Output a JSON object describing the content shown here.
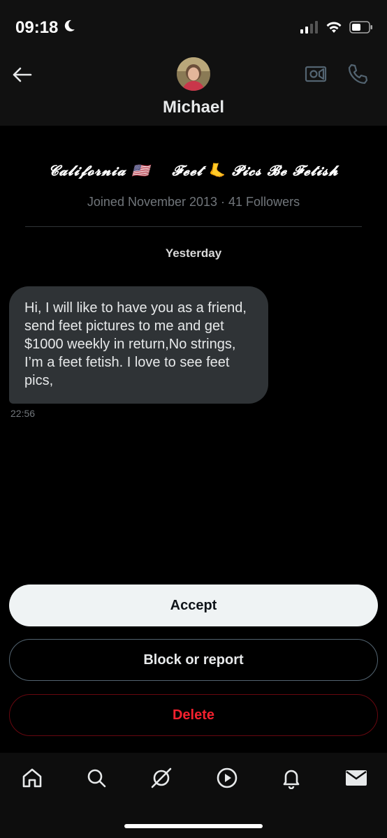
{
  "status_bar": {
    "time": "09:18",
    "icons": [
      "moon-icon",
      "signal-icon",
      "wifi-icon",
      "battery-icon"
    ]
  },
  "header": {
    "name": "Michael",
    "icons": [
      "back-arrow-icon",
      "video-camera-icon",
      "phone-icon"
    ]
  },
  "profile": {
    "bio": "𝓒𝓪𝓵𝓲𝓯𝓸𝓻𝓷𝓲𝓪 🇺🇸    𝓕𝓮𝓮𝓽 🦶 𝓟𝓲𝓬𝓼 𝓑𝓮 𝓕𝓮𝓽𝓲𝓼𝓱",
    "joined": "Joined November 2013",
    "separator": "·",
    "followers": "41 Followers"
  },
  "conversation": {
    "day_label": "Yesterday",
    "messages": [
      {
        "text": "Hi, I will like to have you as a friend, send feet pictures to me and get $1000 weekly in return,No strings, I’m a feet fetish. I love to see feet pics,",
        "time": "22:56"
      }
    ]
  },
  "actions": {
    "accept": "Accept",
    "block_or_report": "Block or report",
    "delete": "Delete"
  },
  "bottom_nav": {
    "items": [
      "home-icon",
      "search-icon",
      "grok-icon",
      "play-icon",
      "bell-icon",
      "mail-icon"
    ]
  },
  "colors": {
    "background": "#000000",
    "bubble": "#2f3336",
    "muted_text": "#71767b",
    "delete_red": "#f4212e",
    "accept_bg": "#eff3f4"
  }
}
